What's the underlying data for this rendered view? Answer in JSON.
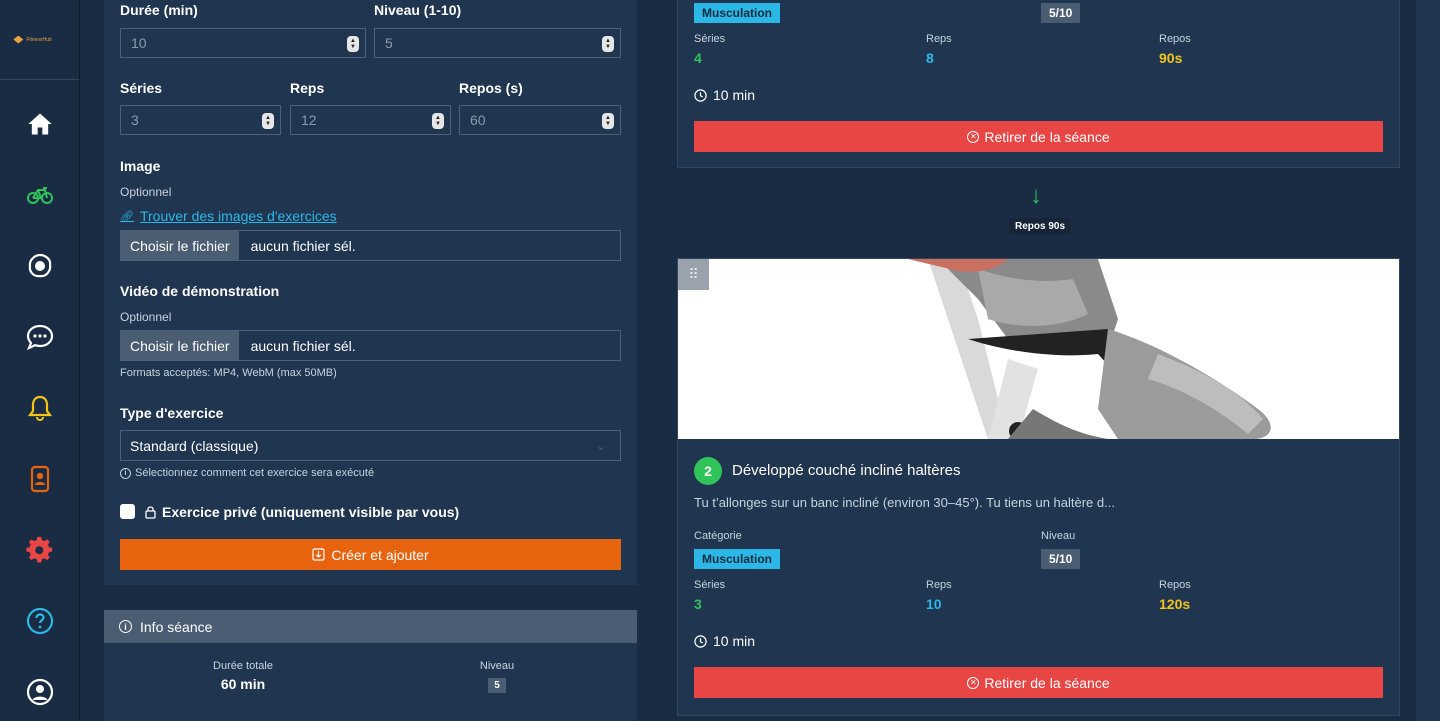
{
  "sidebar": {
    "logo_text": "FitnessHub",
    "items": [
      {
        "name": "home",
        "icon": "home-icon",
        "color": "#ffffff"
      },
      {
        "name": "workouts",
        "icon": "bicycle-icon",
        "color": "#2fc35a"
      },
      {
        "name": "nutrition",
        "icon": "egg-icon",
        "color": "#ffffff"
      },
      {
        "name": "messages",
        "icon": "chat-icon",
        "color": "#ffffff"
      },
      {
        "name": "notifications",
        "icon": "bell-icon",
        "color": "#f2c418"
      },
      {
        "name": "profile-card",
        "icon": "phone-user-icon",
        "color": "#e8630e"
      },
      {
        "name": "settings",
        "icon": "gear-icon",
        "color": "#e84545"
      },
      {
        "name": "help",
        "icon": "question-icon",
        "color": "#2bb8e6"
      },
      {
        "name": "account",
        "icon": "user-circle-icon",
        "color": "#ffffff"
      }
    ]
  },
  "form": {
    "duration_label": "Durée (min)",
    "duration_value": "10",
    "level_label": "Niveau (1-10)",
    "level_value": "5",
    "series_label": "Séries",
    "series_value": "3",
    "reps_label": "Reps",
    "reps_value": "12",
    "rest_label": "Repos (s)",
    "rest_value": "60",
    "image_label": "Image",
    "image_optional": "Optionnel",
    "find_images_link": "Trouver des images d'exercices",
    "choose_file": "Choisir le fichier",
    "no_file": "aucun fichier sél.",
    "video_label": "Vidéo de démonstration",
    "video_optional": "Optionnel",
    "video_choose_file": "Choisir le fichier",
    "video_no_file": "aucun fichier sél.",
    "formats_hint": "Formats acceptés: MP4, WebM (max 50MB)",
    "type_label": "Type d'exercice",
    "type_value": "Standard (classique)",
    "type_hint": "Sélectionnez comment cet exercice sera exécuté",
    "private_label": "Exercice privé (uniquement visible par vous)",
    "submit_label": "Créer et ajouter"
  },
  "session_info": {
    "title": "Info séance",
    "total_duration_label": "Durée totale",
    "total_duration_value": "60 min",
    "level_label": "Niveau",
    "level_value": "5"
  },
  "exercise1": {
    "category": "Musculation",
    "level": "5/10",
    "series_label": "Séries",
    "series_value": "4",
    "reps_label": "Reps",
    "reps_value": "8",
    "rest_label": "Repos",
    "rest_value": "90s",
    "duration": "10 min",
    "remove_label": "Retirer de la séance"
  },
  "rest_between": "Repos 90s",
  "exercise2": {
    "number": "2",
    "title": "Développé couché incliné haltères",
    "description": "Tu t’allonges sur un banc incliné (environ 30–45°). Tu tiens un haltère d...",
    "category_label": "Catégorie",
    "category": "Musculation",
    "level_label": "Niveau",
    "level": "5/10",
    "series_label": "Séries",
    "series_value": "3",
    "reps_label": "Reps",
    "reps_value": "10",
    "rest_label": "Repos",
    "rest_value": "120s",
    "duration": "10 min",
    "remove_label": "Retirer de la séance"
  },
  "colors": {
    "accent_orange": "#e8630e",
    "danger_red": "#e84545",
    "success_green": "#2fc35a",
    "info_blue": "#2bb8e6",
    "warning_yellow": "#f2c418"
  }
}
